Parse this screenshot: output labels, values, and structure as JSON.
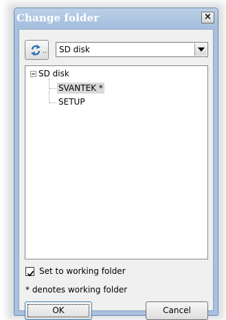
{
  "window": {
    "title": "Change folder",
    "close_label": "×"
  },
  "toolbar": {
    "refresh_icon": "refresh-arrows-icon",
    "refresh_suffix": ".."
  },
  "drive_select": {
    "value": "SD disk"
  },
  "tree": {
    "root": "SD disk",
    "children": [
      "SVANTEK *",
      "SETUP"
    ],
    "selected": "SVANTEK *"
  },
  "options": {
    "working_folder_label": "Set to working folder",
    "working_folder_checked": true
  },
  "note": "* denotes working folder",
  "buttons": {
    "ok": "OK",
    "cancel": "Cancel"
  },
  "colors": {
    "title_bar": "#a8c1df",
    "selection": "#d9d9d9",
    "focus_border": "#3c7fb1"
  }
}
